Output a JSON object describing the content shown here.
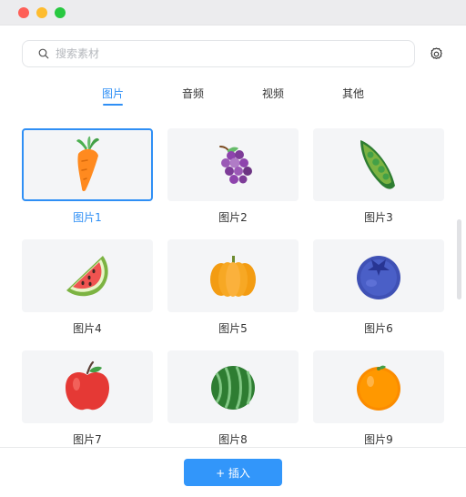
{
  "window": {
    "controls": [
      "close",
      "minimize",
      "maximize"
    ]
  },
  "search": {
    "placeholder": "搜索素材",
    "value": "",
    "icon": "search-icon"
  },
  "settings": {
    "icon": "gear-icon"
  },
  "tabs": [
    {
      "label": "图片",
      "active": true
    },
    {
      "label": "音频",
      "active": false
    },
    {
      "label": "视频",
      "active": false
    },
    {
      "label": "其他",
      "active": false
    }
  ],
  "items": [
    {
      "label": "图片1",
      "icon": "carrot-icon",
      "selected": true
    },
    {
      "label": "图片2",
      "icon": "grapes-icon",
      "selected": false
    },
    {
      "label": "图片3",
      "icon": "peas-icon",
      "selected": false
    },
    {
      "label": "图片4",
      "icon": "watermelon-slice-icon",
      "selected": false
    },
    {
      "label": "图片5",
      "icon": "pumpkin-icon",
      "selected": false
    },
    {
      "label": "图片6",
      "icon": "blueberry-icon",
      "selected": false
    },
    {
      "label": "图片7",
      "icon": "apple-icon",
      "selected": false
    },
    {
      "label": "图片8",
      "icon": "watermelon-icon",
      "selected": false
    },
    {
      "label": "图片9",
      "icon": "orange-icon",
      "selected": false
    }
  ],
  "footer": {
    "insert_label": "+ 插入"
  },
  "colors": {
    "accent": "#2f8ff5",
    "button": "#3296fa",
    "card_bg": "#f4f5f7"
  }
}
